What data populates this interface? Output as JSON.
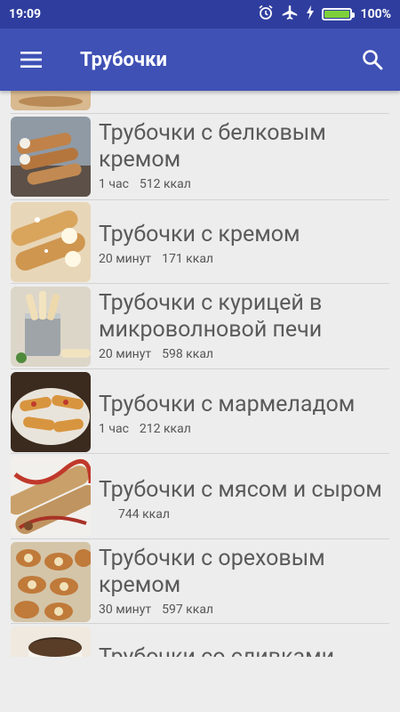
{
  "status_bar": {
    "time": "19:09",
    "battery_text": "100%",
    "battery_level": 1.0,
    "icons": [
      "alarm-icon",
      "airplane-mode-icon",
      "charging-icon",
      "battery-icon"
    ]
  },
  "app_bar": {
    "title": "Трубочки",
    "menu_icon": "hamburger-menu-icon",
    "search_icon": "search-icon",
    "bar_color": "#3f51b5",
    "status_color": "#2f3e9e"
  },
  "recipes": [
    {
      "name": "Трубочки с белковым кремом",
      "time": "1 час",
      "kcal": "512 ккал"
    },
    {
      "name": "Трубочки с кремом",
      "time": "20 минут",
      "kcal": "171 ккал"
    },
    {
      "name": "Трубочки с курицей в микроволновой печи",
      "time": "20 минут",
      "kcal": "598 ккал"
    },
    {
      "name": "Трубочки с мармеладом",
      "time": "1 час",
      "kcal": "212 ккал"
    },
    {
      "name": "Трубочки с мясом и сыром",
      "time": "",
      "kcal": "744 ккал"
    },
    {
      "name": "Трубочки с ореховым кремом",
      "time": "30 минут",
      "kcal": "597 ккал"
    },
    {
      "name": "Трубочки со сливками",
      "time": "",
      "kcal": ""
    }
  ]
}
